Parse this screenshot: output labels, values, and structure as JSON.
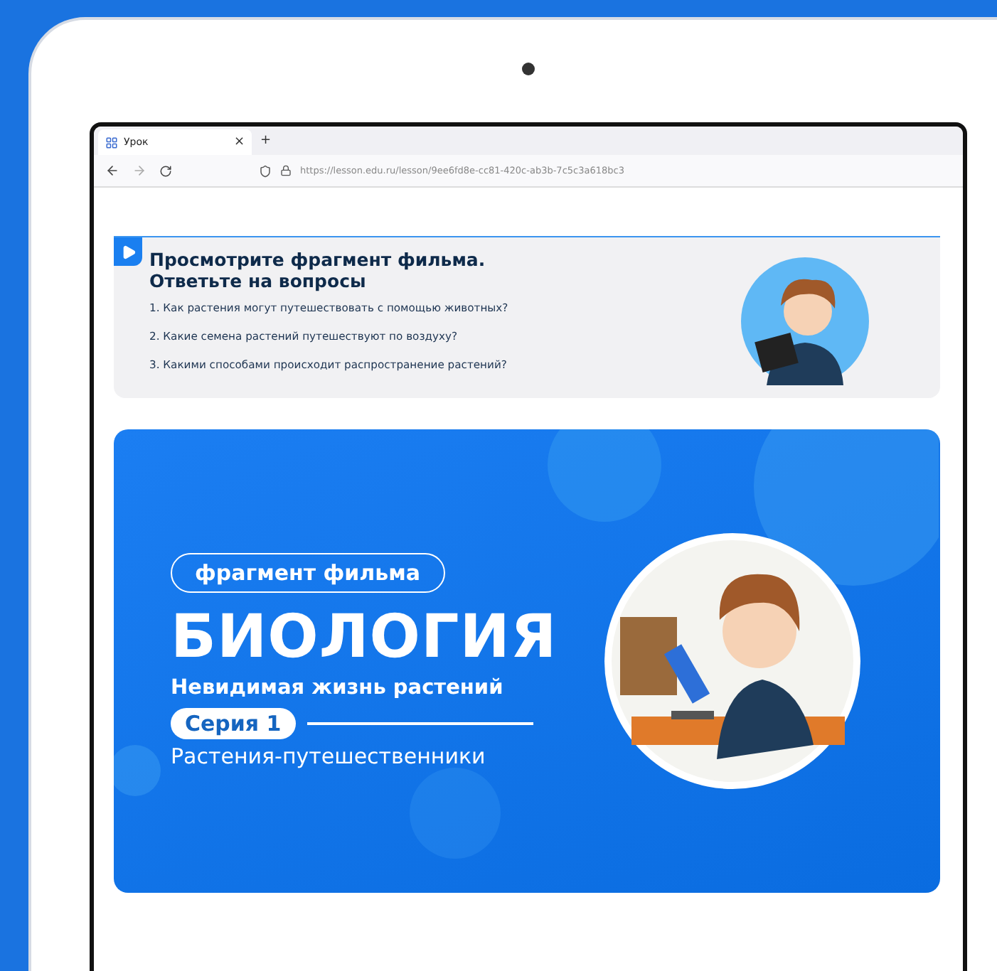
{
  "browser": {
    "tab": {
      "title": "Урок",
      "close": "×",
      "selected": true
    },
    "new_tab": "+",
    "url_host": "https://lesson.edu.ru",
    "url_path": "/lesson/9ee6fd8e-cc81-420c-ab3b-7c5c3a618bc3"
  },
  "task": {
    "title_lines": [
      "Просмотрите фрагмент фильма.",
      "Ответьте на вопросы"
    ],
    "questions": [
      "1. Как растения могут путешествовать с помощью животных?",
      "2. Какие семена растений путешествуют по воздуху?",
      "3. Какими способами происходит распространение растений?"
    ]
  },
  "banner": {
    "tag": "фрагмент фильма",
    "subject": "БИОЛОГИЯ",
    "film": "Невидимая жизнь растений",
    "series": "Серия 1",
    "episode": "Растения-путешественники"
  }
}
